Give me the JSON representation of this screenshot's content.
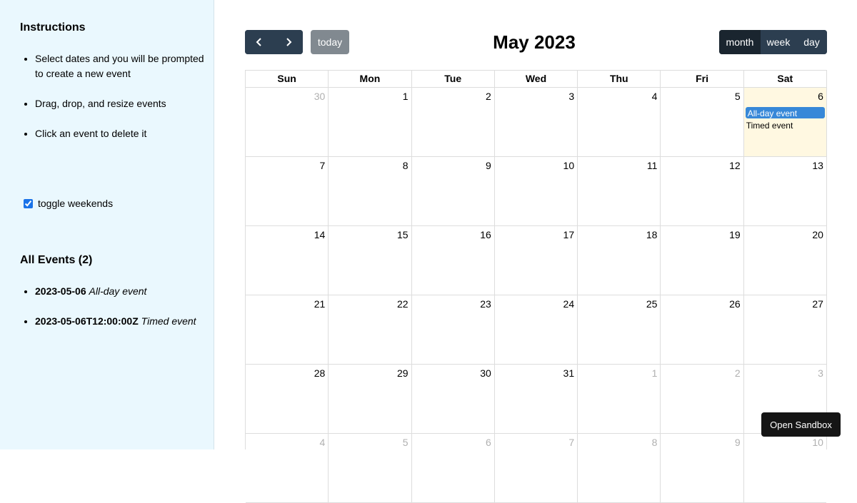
{
  "sidebar": {
    "instructions_title": "Instructions",
    "instructions": [
      "Select dates and you will be prompted to create a new event",
      "Drag, drop, and resize events",
      "Click an event to delete it"
    ],
    "weekends_label": "toggle weekends",
    "weekends_checked": true,
    "events_title": "All Events (2)",
    "events": [
      {
        "date": "2023-05-06",
        "title": "All-day event"
      },
      {
        "date": "2023-05-06T12:00:00Z",
        "title": "Timed event"
      }
    ]
  },
  "toolbar": {
    "prev_icon": "chevron-left-icon",
    "next_icon": "chevron-right-icon",
    "today_label": "today",
    "title": "May 2023",
    "views": [
      "month",
      "week",
      "day"
    ],
    "active_view": "month"
  },
  "calendar": {
    "weekdays": [
      "Sun",
      "Mon",
      "Tue",
      "Wed",
      "Thu",
      "Fri",
      "Sat"
    ],
    "weeks": [
      [
        {
          "d": "30",
          "other": true
        },
        {
          "d": "1"
        },
        {
          "d": "2"
        },
        {
          "d": "3"
        },
        {
          "d": "4"
        },
        {
          "d": "5"
        },
        {
          "d": "6",
          "today": true
        }
      ],
      [
        {
          "d": "7"
        },
        {
          "d": "8"
        },
        {
          "d": "9"
        },
        {
          "d": "10"
        },
        {
          "d": "11"
        },
        {
          "d": "12"
        },
        {
          "d": "13"
        }
      ],
      [
        {
          "d": "14"
        },
        {
          "d": "15"
        },
        {
          "d": "16"
        },
        {
          "d": "17"
        },
        {
          "d": "18"
        },
        {
          "d": "19"
        },
        {
          "d": "20"
        }
      ],
      [
        {
          "d": "21"
        },
        {
          "d": "22"
        },
        {
          "d": "23"
        },
        {
          "d": "24"
        },
        {
          "d": "25"
        },
        {
          "d": "26"
        },
        {
          "d": "27"
        }
      ],
      [
        {
          "d": "28"
        },
        {
          "d": "29"
        },
        {
          "d": "30"
        },
        {
          "d": "31"
        },
        {
          "d": "1",
          "other": true
        },
        {
          "d": "2",
          "other": true
        },
        {
          "d": "3",
          "other": true
        }
      ],
      [
        {
          "d": "4",
          "other": true
        },
        {
          "d": "5",
          "other": true
        },
        {
          "d": "6",
          "other": true
        },
        {
          "d": "7",
          "other": true
        },
        {
          "d": "8",
          "other": true
        },
        {
          "d": "9",
          "other": true
        },
        {
          "d": "10",
          "other": true
        }
      ]
    ],
    "cell_events": {
      "allday": "All-day event",
      "timed": "Timed event"
    }
  },
  "sandbox_label": "Open Sandbox",
  "colors": {
    "sidebar_bg": "#eaf8fe",
    "button_bg": "#2c3e50",
    "event_bg": "#3788d8",
    "today_bg": "#fff8e1"
  }
}
